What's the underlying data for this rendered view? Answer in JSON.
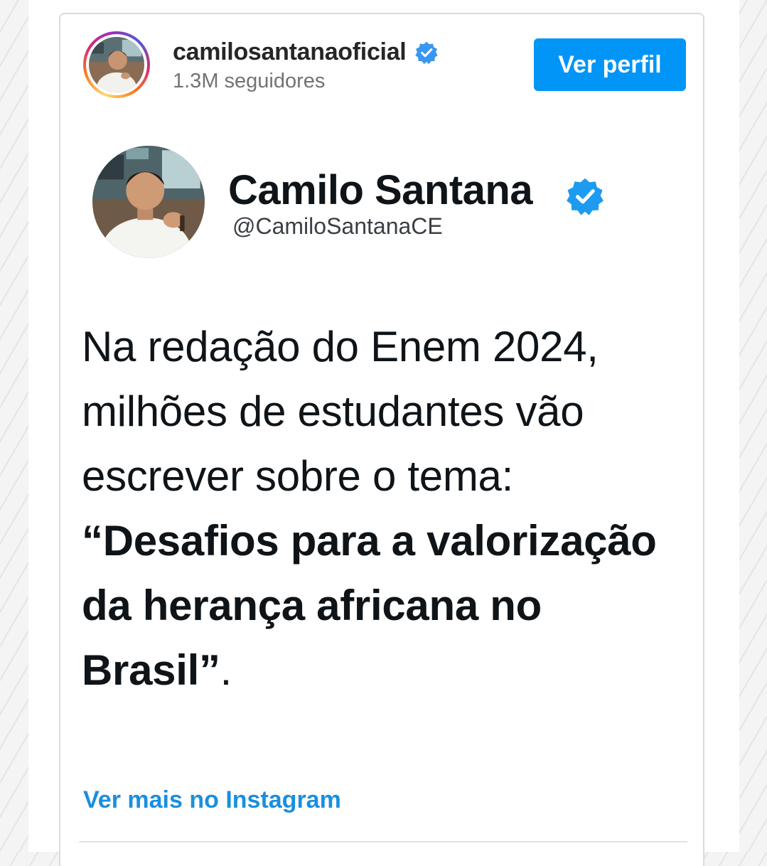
{
  "header": {
    "username": "camilosantanaoficial",
    "followers": "1.3M seguidores",
    "profile_button_label": "Ver perfil"
  },
  "tweet": {
    "display_name": "Camilo Santana",
    "handle": "@CamiloSantanaCE",
    "text_regular": "Na redação do Enem 2024, milhões de estudantes vão escrever sobre o tema:",
    "text_bold": "“Desafios para a valorização da herança africana no Brasil”",
    "text_end": "."
  },
  "footer": {
    "more_link_label": "Ver mais no Instagram"
  },
  "colors": {
    "accent": "#0095f6",
    "verified": "#3897f0",
    "link": "#1a8fe0",
    "text_primary": "#262626",
    "text_secondary": "#737373"
  },
  "icons": {
    "verified": "verified-badge-icon"
  }
}
